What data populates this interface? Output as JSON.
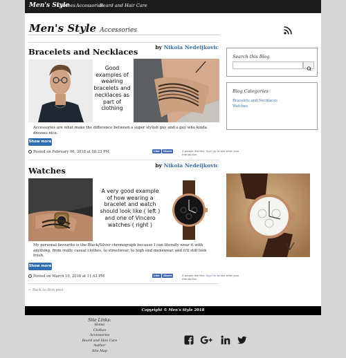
{
  "nav": {
    "brand": "Men's Style",
    "items": [
      "Clothes",
      "Accessories",
      "Beard and Hair Care"
    ]
  },
  "page_title": {
    "main": "Men's Style",
    "sub": "Accessories"
  },
  "posts": [
    {
      "title": "Bracelets and Necklaces",
      "by_label": "by",
      "author": "Nikola Nedeljkovic",
      "caption": "Good examples of wearing bracelets and necklaces as part of clothing",
      "excerpt": "Accessories are what make the difference between a super stylish guy and a guy who kinda dresses nice.",
      "button": "Show more",
      "posted": "Posted on February 06, 2018 at 08:23 PM",
      "fb": {
        "like": "Like",
        "share": "Share",
        "text_a": "2 people like this.",
        "signup": "Sign Up",
        "text_b": " to see what your friends like."
      }
    },
    {
      "title": "Watches",
      "by_label": "by",
      "author": "Nikola Nedeljkovic",
      "caption": "A very good example of how wearing a bracelet and watch should look like ( left ) and one of Vincero watches ( right )",
      "excerpt": "My personal favourite is the Black/Silver chronograph because I can literally wear it with anything, from really casual clothes, to streetwear, to high end menswear, and it'll still look fresh.",
      "button": "Show more",
      "posted": "Posted on March 10, 2018 at 11:43 PM",
      "fb": {
        "like": "Like",
        "share": "Share",
        "text_a": "4 people like this.",
        "signup": "Sign Up",
        "text_b": " to see what your friends like."
      }
    }
  ],
  "back_link": "← Back to first post",
  "sidebar": {
    "search_title": "Search this Blog",
    "categories_title": "Blog Categories",
    "categories": [
      "Bracelets and Necklaces",
      "Watches"
    ]
  },
  "footer": {
    "copyright": "Copyright © Men's Style 2018",
    "site_links_title": "Site Links:",
    "site_links": [
      "Home",
      "Clothes",
      "Accessories",
      "Beard and Skin Care",
      "Author",
      "Site Map"
    ]
  },
  "icons": [
    "rss-icon",
    "search-icon",
    "facebook-icon",
    "google-plus-icon",
    "linkedin-icon",
    "twitter-icon"
  ],
  "colors": {
    "nav": "#1c1c1c",
    "link": "#3a6fa8",
    "button": "#2f6db0",
    "facebook": "#4267b2"
  }
}
